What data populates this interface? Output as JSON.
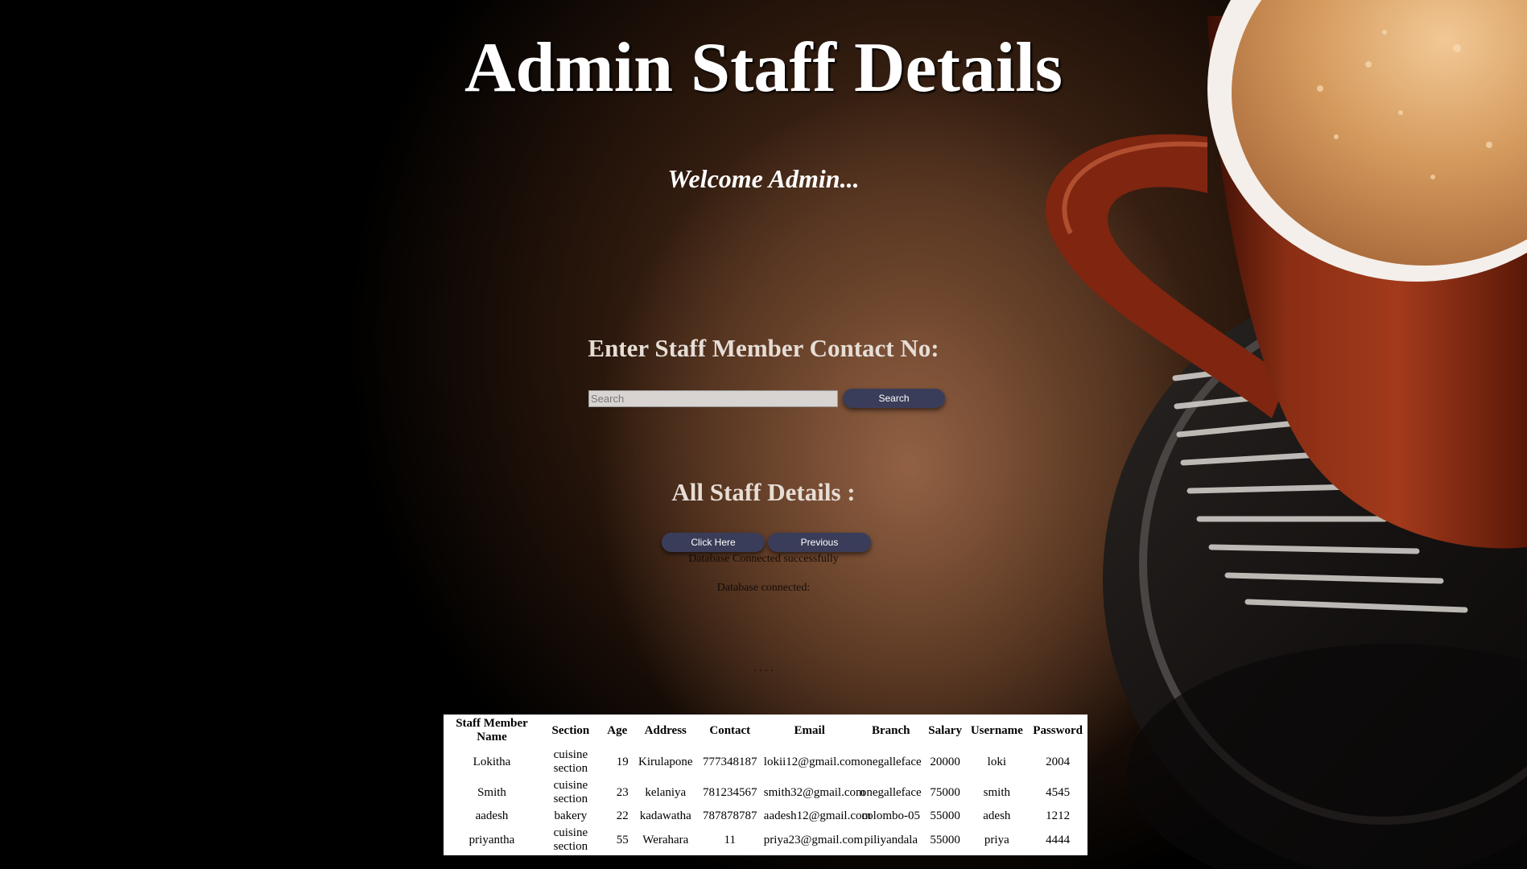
{
  "page": {
    "title": "Admin Staff Details",
    "welcome": "Welcome Admin..."
  },
  "search": {
    "heading": "Enter Staff Member Contact No:",
    "placeholder": "Search",
    "value": "",
    "button_label": "Search"
  },
  "all_staff": {
    "heading": "All Staff Details :",
    "click_here_label": "Click Here",
    "previous_label": "Previous"
  },
  "status": {
    "line1": "Database Connected successfully",
    "line2": "Database connected:",
    "line3": ". . . ."
  },
  "table": {
    "headers": [
      "Staff Member Name",
      "Section",
      "Age",
      "Address",
      "Contact",
      "Email",
      "Branch",
      "Salary",
      "Username",
      "Password"
    ],
    "rows": [
      [
        "Lokitha",
        "cuisine section",
        "19",
        "Kirulapone",
        "777348187",
        "lokii12@gmail.com",
        "onegalleface",
        "20000",
        "loki",
        "2004"
      ],
      [
        "Smith",
        "cuisine section",
        "23",
        "kelaniya",
        "781234567",
        "smith32@gmail.com",
        "onegalleface",
        "75000",
        "smith",
        "4545"
      ],
      [
        "aadesh",
        "bakery",
        "22",
        "kadawatha",
        "787878787",
        "aadesh12@gmail.com",
        "colombo-05",
        "55000",
        "adesh",
        "1212"
      ],
      [
        "priyantha",
        "cuisine section",
        "55",
        "Werahara",
        "11",
        "priya23@gmail.com",
        "piliyandala",
        "55000",
        "priya",
        "4444"
      ]
    ]
  },
  "colors": {
    "button_bg": "#3a3d59",
    "title_text": "#ffffff",
    "background": "#000000",
    "cup": "#7a2412",
    "coffee": "#c88a4e"
  },
  "icons": {
    "background_image": "coffee-cup-image"
  }
}
